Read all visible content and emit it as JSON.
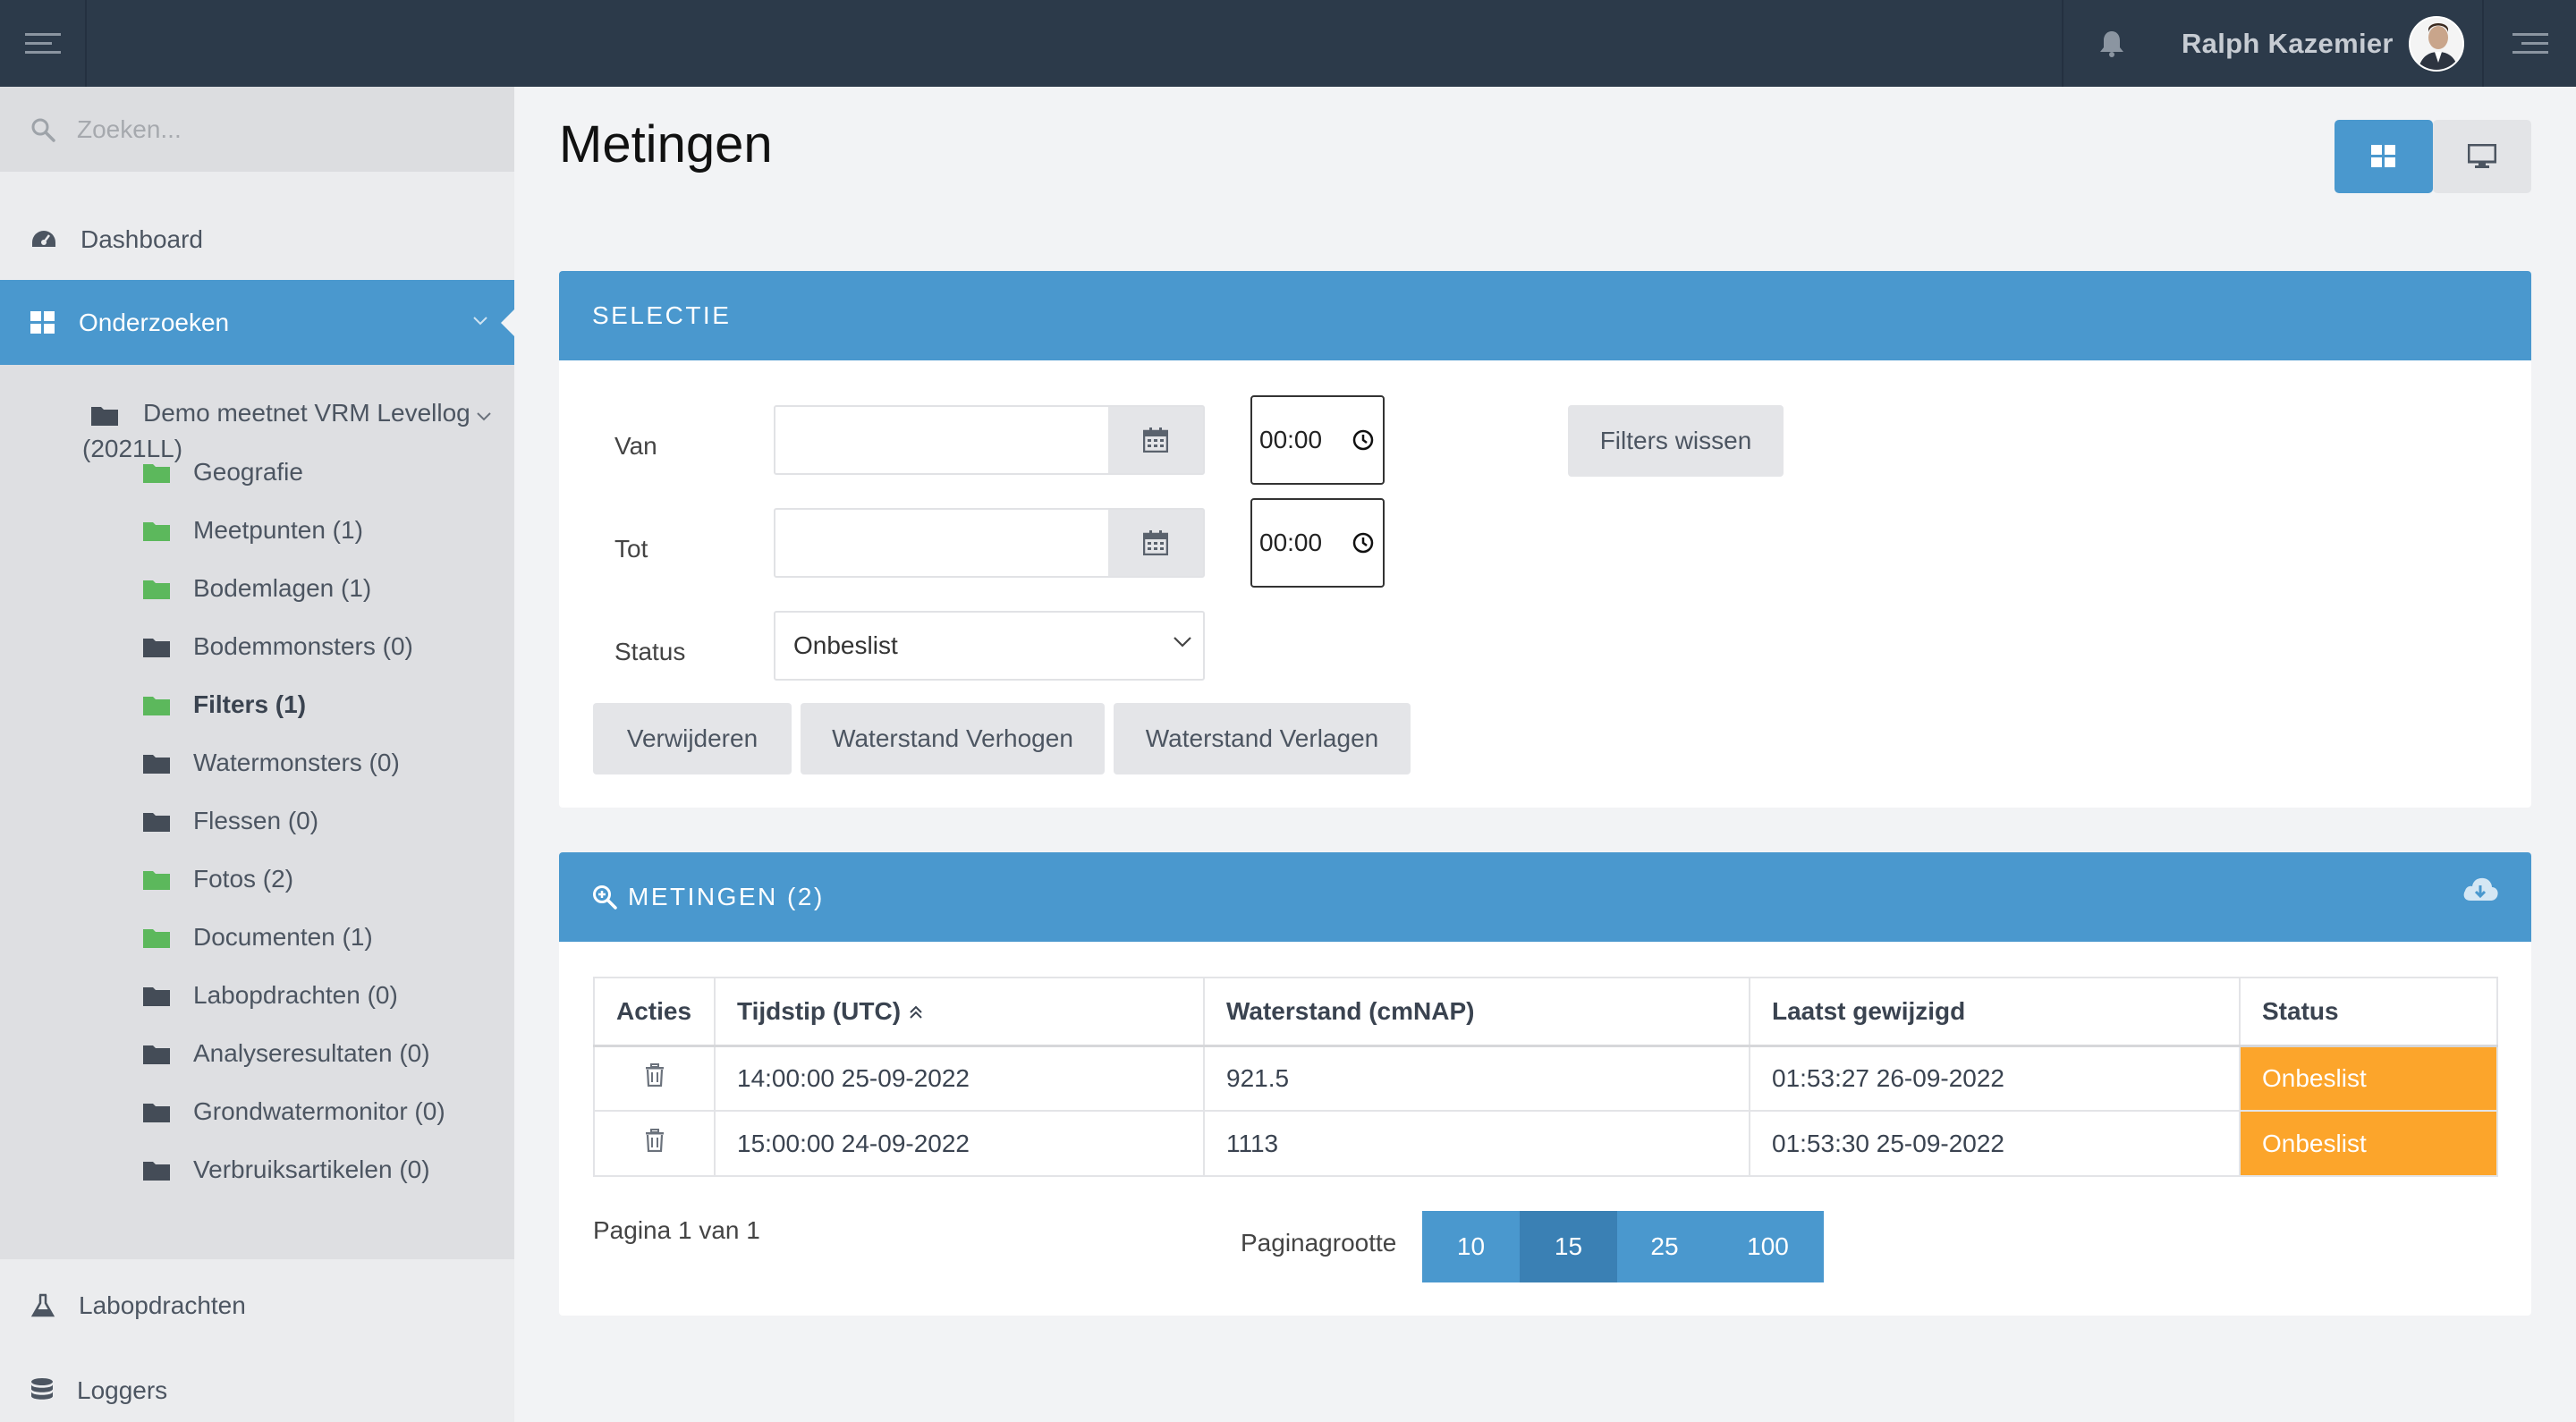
{
  "header": {
    "user_name": "Ralph Kazemier"
  },
  "sidebar": {
    "search_placeholder": "Zoeken...",
    "items": [
      {
        "label": "Dashboard",
        "icon": "dashboard-icon"
      },
      {
        "label": "Onderzoeken",
        "icon": "grid-icon",
        "active": true
      },
      {
        "label": "Labopdrachten",
        "icon": "flask-icon"
      },
      {
        "label": "Loggers",
        "icon": "database-icon"
      }
    ],
    "tree_root": "Demo meetnet VRM Levellog (2021LL)",
    "tree": [
      {
        "label": "Geografie",
        "icon": "folder-green-icon"
      },
      {
        "label": "Meetpunten (1)",
        "icon": "folder-green-icon"
      },
      {
        "label": "Bodemlagen (1)",
        "icon": "folder-green-icon"
      },
      {
        "label": "Bodemmonsters (0)",
        "icon": "folder-icon"
      },
      {
        "label": "Filters (1)",
        "icon": "folder-green-icon",
        "bold": true
      },
      {
        "label": "Watermonsters (0)",
        "icon": "folder-icon"
      },
      {
        "label": "Flessen (0)",
        "icon": "folder-icon"
      },
      {
        "label": "Fotos (2)",
        "icon": "folder-green-icon"
      },
      {
        "label": "Documenten (1)",
        "icon": "folder-green-icon"
      },
      {
        "label": "Labopdrachten (0)",
        "icon": "folder-icon"
      },
      {
        "label": "Analyseresultaten (0)",
        "icon": "folder-icon"
      },
      {
        "label": "Grondwatermonitor (0)",
        "icon": "folder-icon"
      },
      {
        "label": "Verbruiksartikelen (0)",
        "icon": "folder-icon"
      }
    ]
  },
  "main": {
    "title": "Metingen",
    "selectie": {
      "heading": "SELECTIE",
      "van_label": "Van",
      "tot_label": "Tot",
      "status_label": "Status",
      "van_time": "00:00",
      "tot_time": "00:00",
      "status_value": "Onbeslist",
      "clear_filters": "Filters wissen",
      "btn_delete": "Verwijderen",
      "btn_raise": "Waterstand Verhogen",
      "btn_lower": "Waterstand Verlagen"
    },
    "metingen": {
      "heading": "METINGEN (2)",
      "columns": [
        "Acties",
        "Tijdstip (UTC)",
        "Waterstand (cmNAP)",
        "Laatst gewijzigd",
        "Status"
      ],
      "rows": [
        {
          "tijdstip": "14:00:00 25-09-2022",
          "waterstand": "921.5",
          "gewijzigd": "01:53:27 26-09-2022",
          "status": "Onbeslist"
        },
        {
          "tijdstip": "15:00:00 24-09-2022",
          "waterstand": "1113",
          "gewijzigd": "01:53:30 25-09-2022",
          "status": "Onbeslist"
        }
      ],
      "pager_info": "Pagina 1 van 1",
      "page_size_label": "Paginagrootte",
      "page_sizes": [
        "10",
        "15",
        "25",
        "100"
      ],
      "page_size_selected": "15"
    }
  },
  "colors": {
    "topbar": "#2c3a4a",
    "accent": "#4a98ce",
    "status_undecided": "#fca52b"
  }
}
